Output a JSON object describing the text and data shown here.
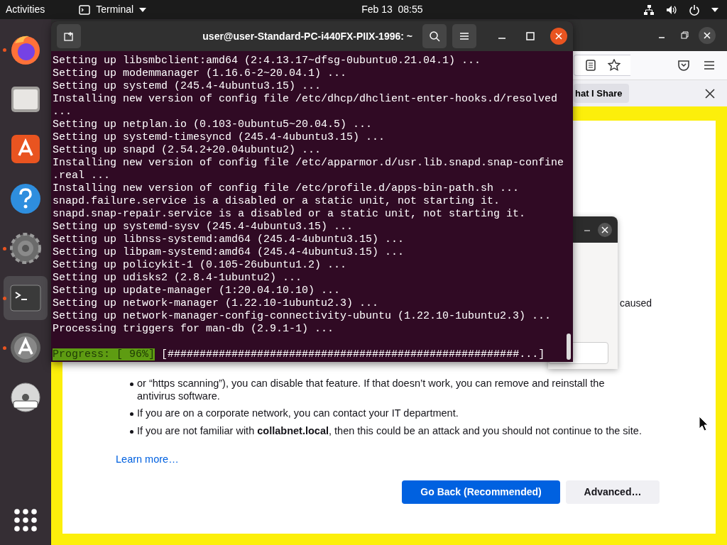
{
  "top_bar": {
    "activities": "Activities",
    "app_menu": "Terminal",
    "clock": "Feb 13  08:55"
  },
  "dock": {
    "items": [
      {
        "kind": "firefox",
        "running": true,
        "selected": false
      },
      {
        "kind": "files",
        "running": false,
        "selected": false
      },
      {
        "kind": "store",
        "running": false,
        "selected": false
      },
      {
        "kind": "help",
        "running": false,
        "selected": false
      },
      {
        "kind": "settings",
        "running": true,
        "selected": false
      },
      {
        "kind": "terminal",
        "running": true,
        "selected": true
      },
      {
        "kind": "updater",
        "running": true,
        "selected": false
      },
      {
        "kind": "dvd",
        "running": false,
        "selected": false
      }
    ]
  },
  "browser": {
    "notification_button": "hat I Share",
    "page": {
      "hidden_fragment": "caused",
      "bullets": [
        "or “https scanning”), you can disable that feature. If that doesn’t work, you can remove and reinstall the antivirus software.",
        "If you are on a corporate network, you can contact your IT department.",
        "If you are not familiar with **collabnet.local**, then this could be an attack and you should not continue to the site."
      ],
      "learn_more": "Learn more…",
      "buttons": [
        {
          "label": "Go Back (Recommended)",
          "primary": true
        },
        {
          "label": "Advanced…",
          "primary": false
        }
      ]
    }
  },
  "terminal": {
    "title": "user@user-Standard-PC-i440FX-PIIX-1996: ~",
    "lines": [
      "Setting up libsmbclient:amd64 (2:4.13.17~dfsg-0ubuntu0.21.04.1) ...",
      "Setting up modemmanager (1.16.6-2~20.04.1) ...",
      "Setting up systemd (245.4-4ubuntu3.15) ...",
      "Installing new version of config file /etc/dhcp/dhclient-enter-hooks.d/resolved",
      "...",
      "Setting up netplan.io (0.103-0ubuntu5~20.04.5) ...",
      "Setting up systemd-timesyncd (245.4-4ubuntu3.15) ...",
      "Setting up snapd (2.54.2+20.04ubuntu2) ...",
      "Installing new version of config file /etc/apparmor.d/usr.lib.snapd.snap-confine",
      ".real ...",
      "Installing new version of config file /etc/profile.d/apps-bin-path.sh ...",
      "snapd.failure.service is a disabled or a static unit, not starting it.",
      "snapd.snap-repair.service is a disabled or a static unit, not starting it.",
      "Setting up systemd-sysv (245.4-4ubuntu3.15) ...",
      "Setting up libnss-systemd:amd64 (245.4-4ubuntu3.15) ...",
      "Setting up libpam-systemd:amd64 (245.4-4ubuntu3.15) ...",
      "Setting up policykit-1 (0.105-26ubuntu1.2) ...",
      "Setting up udisks2 (2.8.4-1ubuntu2) ...",
      "Setting up update-manager (1:20.04.10.10) ...",
      "Setting up network-manager (1.22.10-1ubuntu2.3) ...",
      "Setting up network-manager-config-connectivity-ubuntu (1.22.10-1ubuntu2.3) ...",
      "Processing triggers for man-db (2.9.1-1) ..."
    ],
    "progress_label": "Progress: [ 96%]",
    "progress_bar": "[#######################################################...]"
  }
}
